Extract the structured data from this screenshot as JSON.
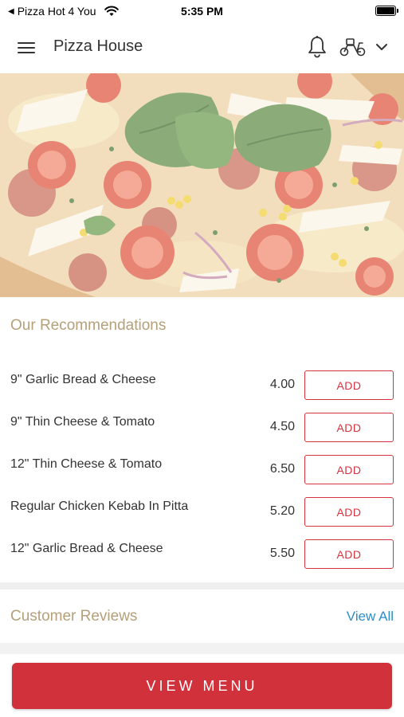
{
  "status_bar": {
    "back_label": "Pizza Hot 4 You",
    "time": "5:35 PM",
    "icons": [
      "back-triangle-icon",
      "wifi-icon",
      "battery-icon"
    ]
  },
  "header": {
    "title": "Pizza House",
    "icons": [
      "hamburger-menu-icon",
      "bell-icon",
      "delivery-scooter-icon",
      "chevron-down-icon"
    ]
  },
  "hero": {
    "image": "pizza-hero-image"
  },
  "recommendations": {
    "title": "Our Recommendations",
    "add_label": "ADD",
    "items": [
      {
        "name": "9\" Garlic Bread & Cheese",
        "price": "4.00"
      },
      {
        "name": "9\" Thin Cheese & Tomato",
        "price": "4.50"
      },
      {
        "name": "12\" Thin Cheese & Tomato",
        "price": "6.50"
      },
      {
        "name": "Regular Chicken Kebab In Pitta",
        "price": "5.20"
      },
      {
        "name": "12\" Garlic Bread & Cheese",
        "price": "5.50"
      }
    ]
  },
  "reviews": {
    "title": "Customer Reviews",
    "view_all": "View All"
  },
  "cta": {
    "label": "VIEW MENU"
  },
  "colors": {
    "accent_red": "#d1313a",
    "section_title_gold": "#b5a07a",
    "link_blue": "#2a8fc9"
  }
}
